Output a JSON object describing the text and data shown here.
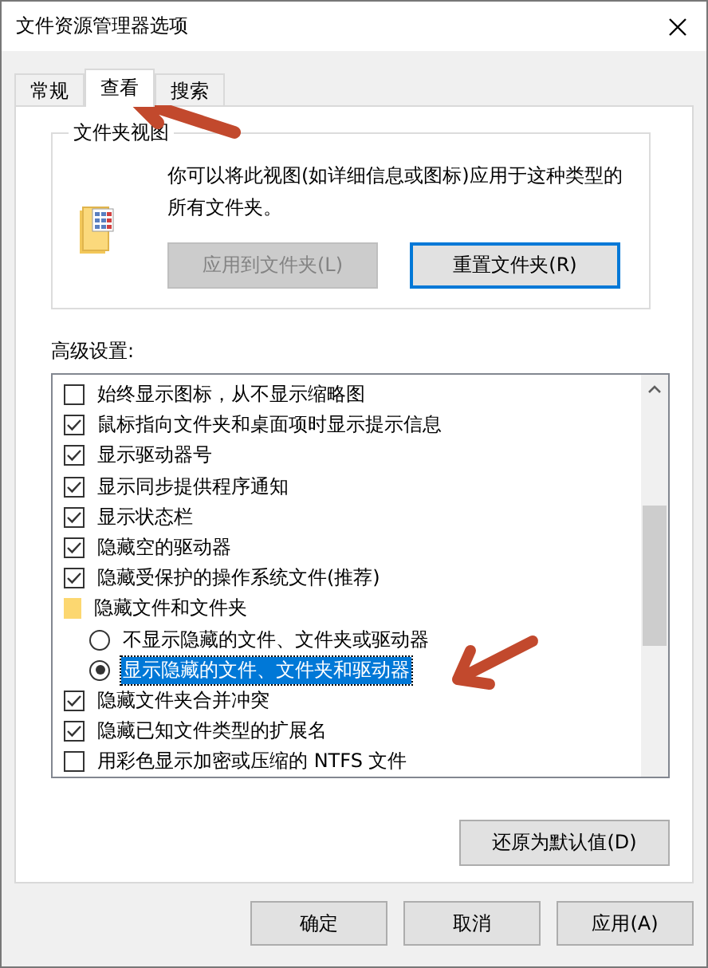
{
  "window": {
    "title": "文件资源管理器选项"
  },
  "tabs": [
    {
      "label": "常规",
      "selected": false
    },
    {
      "label": "查看",
      "selected": true
    },
    {
      "label": "搜索",
      "selected": false
    }
  ],
  "folder_views": {
    "title": "文件夹视图",
    "description": "你可以将此视图(如详细信息或图标)应用于这种类型的所有文件夹。",
    "buttons": [
      {
        "label": "应用到文件夹(L)",
        "disabled": true
      },
      {
        "label": "重置文件夹(R)",
        "disabled": false
      }
    ]
  },
  "advanced": {
    "label": "高级设置:",
    "items": [
      {
        "kind": "checkbox",
        "label": "始终显示图标，从不显示缩略图",
        "checked": false
      },
      {
        "kind": "checkbox",
        "label": "鼠标指向文件夹和桌面项时显示提示信息",
        "checked": true
      },
      {
        "kind": "checkbox",
        "label": "显示驱动器号",
        "checked": true
      },
      {
        "kind": "checkbox",
        "label": "显示同步提供程序通知",
        "checked": true
      },
      {
        "kind": "checkbox",
        "label": "显示状态栏",
        "checked": true
      },
      {
        "kind": "checkbox",
        "label": "隐藏空的驱动器",
        "checked": true
      },
      {
        "kind": "checkbox",
        "label": "隐藏受保护的操作系统文件(推荐)",
        "checked": true
      },
      {
        "kind": "folder",
        "label": "隐藏文件和文件夹",
        "children": [
          {
            "kind": "radio",
            "label": "不显示隐藏的文件、文件夹或驱动器",
            "selected": false
          },
          {
            "kind": "radio",
            "label": "显示隐藏的文件、文件夹和驱动器",
            "selected": true
          }
        ]
      },
      {
        "kind": "checkbox",
        "label": "隐藏文件夹合并冲突",
        "checked": true
      },
      {
        "kind": "checkbox",
        "label": "隐藏已知文件类型的扩展名",
        "checked": true
      },
      {
        "kind": "checkbox",
        "label": "用彩色显示加密或压缩的 NTFS 文件",
        "checked": false
      }
    ],
    "restore_button": "还原为默认值(D)"
  },
  "buttons": [
    "确定",
    "取消",
    "应用(A)"
  ]
}
